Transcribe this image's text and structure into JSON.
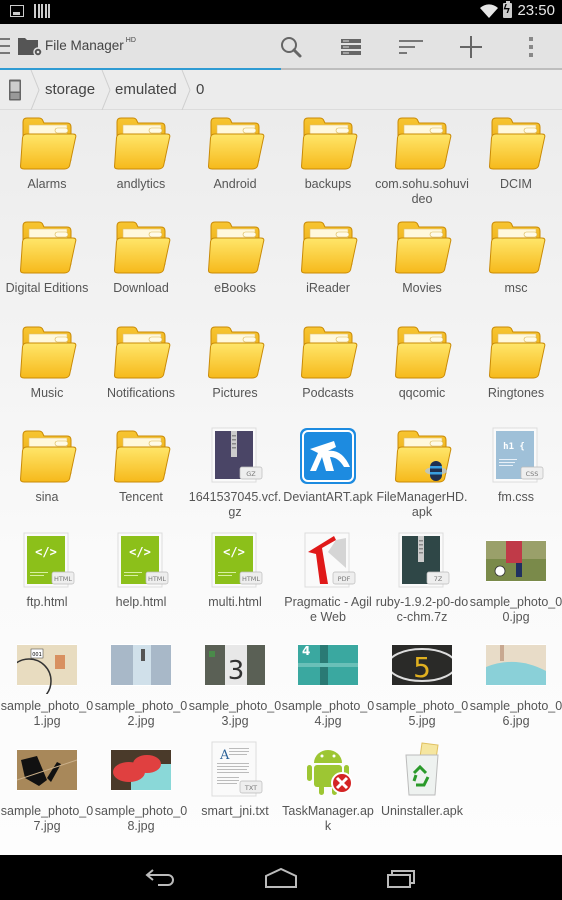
{
  "status_bar": {
    "time": "23:50",
    "icons": [
      "picture-notification-icon",
      "barcode-notification-icon",
      "wifi-icon",
      "battery-charging-icon"
    ]
  },
  "action_bar": {
    "title": "File Manager",
    "title_badge": "HD",
    "buttons": [
      "search",
      "view-mode",
      "sort",
      "add",
      "overflow-menu"
    ],
    "colors": {
      "accent": "#2f9bd3",
      "background": "#e3e3e3"
    }
  },
  "breadcrumb": {
    "root_icon": "phone-storage-icon",
    "items": [
      "storage",
      "emulated",
      "0"
    ]
  },
  "files": [
    {
      "name": "Alarms",
      "type": "folder"
    },
    {
      "name": "andlytics",
      "type": "folder"
    },
    {
      "name": "Android",
      "type": "folder"
    },
    {
      "name": "backups",
      "type": "folder"
    },
    {
      "name": "com.sohu.sohuvideo",
      "type": "folder"
    },
    {
      "name": "DCIM",
      "type": "folder"
    },
    {
      "name": "Digital Editions",
      "type": "folder"
    },
    {
      "name": "Download",
      "type": "folder"
    },
    {
      "name": "eBooks",
      "type": "folder"
    },
    {
      "name": "iReader",
      "type": "folder"
    },
    {
      "name": "Movies",
      "type": "folder"
    },
    {
      "name": "msc",
      "type": "folder"
    },
    {
      "name": "Music",
      "type": "folder"
    },
    {
      "name": "Notifications",
      "type": "folder"
    },
    {
      "name": "Pictures",
      "type": "folder"
    },
    {
      "name": "Podcasts",
      "type": "folder"
    },
    {
      "name": "qqcomic",
      "type": "folder"
    },
    {
      "name": "Ringtones",
      "type": "folder"
    },
    {
      "name": "sina",
      "type": "folder"
    },
    {
      "name": "Tencent",
      "type": "folder"
    },
    {
      "name": "1641537045.vcf.gz",
      "type": "archive",
      "badge": "GZ"
    },
    {
      "name": "DeviantART.apk",
      "type": "apk-deviantart"
    },
    {
      "name": "FileManagerHD.apk",
      "type": "apk-filemanager"
    },
    {
      "name": "fm.css",
      "type": "css",
      "badge": "CSS"
    },
    {
      "name": "ftp.html",
      "type": "html",
      "badge": "HTML"
    },
    {
      "name": "help.html",
      "type": "html",
      "badge": "HTML"
    },
    {
      "name": "multi.html",
      "type": "html",
      "badge": "HTML"
    },
    {
      "name": "Pragmatic - Agile Web",
      "type": "pdf",
      "badge": "PDF"
    },
    {
      "name": "ruby-1.9.2-p0-doc-chm.7z",
      "type": "archive7z",
      "badge": "7Z"
    },
    {
      "name": "sample_photo_00.jpg",
      "type": "photo",
      "photo": "soccer"
    },
    {
      "name": "sample_photo_01.jpg",
      "type": "photo",
      "photo": "bike"
    },
    {
      "name": "sample_photo_02.jpg",
      "type": "photo",
      "photo": "glass"
    },
    {
      "name": "sample_photo_03.jpg",
      "type": "photo",
      "photo": "pillar"
    },
    {
      "name": "sample_photo_04.jpg",
      "type": "photo",
      "photo": "door"
    },
    {
      "name": "sample_photo_05.jpg",
      "type": "photo",
      "photo": "five"
    },
    {
      "name": "sample_photo_06.jpg",
      "type": "photo",
      "photo": "pool"
    },
    {
      "name": "sample_photo_07.jpg",
      "type": "photo",
      "photo": "shadow"
    },
    {
      "name": "sample_photo_08.jpg",
      "type": "photo",
      "photo": "shoes"
    },
    {
      "name": "smart_jni.txt",
      "type": "txt",
      "badge": "TXT"
    },
    {
      "name": "TaskManager.apk",
      "type": "apk-taskmanager"
    },
    {
      "name": "Uninstaller.apk",
      "type": "apk-uninstaller"
    }
  ],
  "nav_bar": {
    "buttons": [
      "back",
      "home",
      "recent-apps"
    ]
  }
}
